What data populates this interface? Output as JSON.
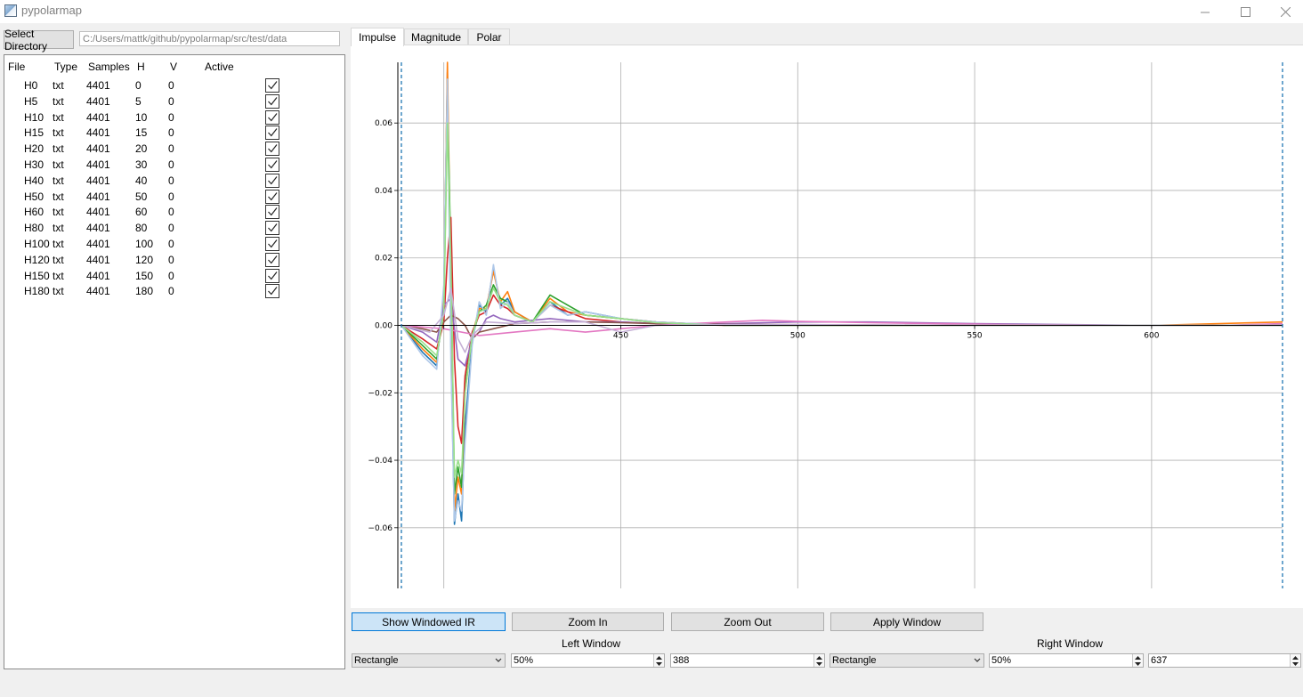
{
  "window": {
    "title": "pypolarmap"
  },
  "toolbar": {
    "select_directory_label": "Select Directory",
    "directory_path": "C:/Users/mattk/github/pypolarmap/src/test/data"
  },
  "table": {
    "columns": [
      "File",
      "Type",
      "Samples",
      "H",
      "V",
      "Active"
    ],
    "rows": [
      {
        "file": "H0",
        "type": "txt",
        "samples": "4401",
        "h": "0",
        "v": "0",
        "active": true
      },
      {
        "file": "H5",
        "type": "txt",
        "samples": "4401",
        "h": "5",
        "v": "0",
        "active": true
      },
      {
        "file": "H10",
        "type": "txt",
        "samples": "4401",
        "h": "10",
        "v": "0",
        "active": true
      },
      {
        "file": "H15",
        "type": "txt",
        "samples": "4401",
        "h": "15",
        "v": "0",
        "active": true
      },
      {
        "file": "H20",
        "type": "txt",
        "samples": "4401",
        "h": "20",
        "v": "0",
        "active": true
      },
      {
        "file": "H30",
        "type": "txt",
        "samples": "4401",
        "h": "30",
        "v": "0",
        "active": true
      },
      {
        "file": "H40",
        "type": "txt",
        "samples": "4401",
        "h": "40",
        "v": "0",
        "active": true
      },
      {
        "file": "H50",
        "type": "txt",
        "samples": "4401",
        "h": "50",
        "v": "0",
        "active": true
      },
      {
        "file": "H60",
        "type": "txt",
        "samples": "4401",
        "h": "60",
        "v": "0",
        "active": true
      },
      {
        "file": "H80",
        "type": "txt",
        "samples": "4401",
        "h": "80",
        "v": "0",
        "active": true
      },
      {
        "file": "H100",
        "type": "txt",
        "samples": "4401",
        "h": "100",
        "v": "0",
        "active": true
      },
      {
        "file": "H120",
        "type": "txt",
        "samples": "4401",
        "h": "120",
        "v": "0",
        "active": true
      },
      {
        "file": "H150",
        "type": "txt",
        "samples": "4401",
        "h": "150",
        "v": "0",
        "active": true
      },
      {
        "file": "H180",
        "type": "txt",
        "samples": "4401",
        "h": "180",
        "v": "0",
        "active": true
      }
    ]
  },
  "tabs": [
    {
      "label": "Impulse",
      "selected": true
    },
    {
      "label": "Magnitude",
      "selected": false
    },
    {
      "label": "Polar",
      "selected": false
    }
  ],
  "buttons": {
    "show_windowed_ir": "Show Windowed IR",
    "zoom_in": "Zoom In",
    "zoom_out": "Zoom Out",
    "apply_window": "Apply Window"
  },
  "left_window": {
    "label": "Left Window",
    "type": "Rectangle",
    "percent": "50%",
    "position": "388"
  },
  "right_window": {
    "label": "Right Window",
    "type": "Rectangle",
    "percent": "50%",
    "position": "637"
  },
  "colors": {
    "accent_active": "#cce4f7",
    "accent_border": "#0078d7",
    "window_marker": "#1f77b4"
  },
  "chart_data": {
    "type": "line",
    "xlim": [
      387,
      637
    ],
    "ylim": [
      -0.078,
      0.078
    ],
    "x_ticks": [
      400,
      450,
      500,
      550,
      600
    ],
    "x_tick_labels": [
      "",
      "450",
      "500",
      "550",
      "600"
    ],
    "y_ticks": [
      0.06,
      0.04,
      0.02,
      0.0,
      -0.02,
      -0.04,
      -0.06
    ],
    "y_tick_labels": [
      "0.06",
      "0.04",
      "0.02",
      "0.00",
      "−0.02",
      "−0.04",
      "−0.06"
    ],
    "grid": true,
    "window_markers": [
      388,
      637
    ],
    "series": [
      {
        "color": "#1f77b4",
        "x": [
          388,
          394,
          398,
          400,
          401,
          402,
          403,
          404,
          405,
          406,
          408,
          410,
          412,
          414,
          416,
          418,
          420,
          425,
          430,
          435,
          440,
          450,
          460,
          470,
          480,
          500,
          550,
          600,
          637
        ],
        "y": [
          0,
          -0.008,
          -0.012,
          0.01,
          0.075,
          -0.005,
          -0.059,
          -0.05,
          -0.058,
          -0.03,
          -0.005,
          0.006,
          0.004,
          0.017,
          0.006,
          0.008,
          0.004,
          0.001,
          0.007,
          0.003,
          0.004,
          0.002,
          0.001,
          0.0005,
          0,
          0,
          0,
          0,
          0
        ]
      },
      {
        "color": "#ff7f0e",
        "x": [
          388,
          394,
          398,
          400,
          401,
          402,
          403,
          404,
          405,
          406,
          408,
          410,
          412,
          414,
          416,
          418,
          420,
          425,
          430,
          435,
          440,
          450,
          460,
          470,
          480,
          500,
          550,
          600,
          637
        ],
        "y": [
          0,
          -0.007,
          -0.011,
          0.008,
          0.078,
          0.01,
          -0.055,
          -0.045,
          -0.05,
          -0.02,
          -0.003,
          0.005,
          0.005,
          0.016,
          0.007,
          0.01,
          0.004,
          0.001,
          0.008,
          0.004,
          0.003,
          0.002,
          0.001,
          0.0005,
          0,
          0,
          0,
          0,
          0.001
        ]
      },
      {
        "color": "#2ca02c",
        "x": [
          388,
          394,
          398,
          400,
          401,
          402,
          403,
          404,
          405,
          406,
          408,
          410,
          412,
          414,
          416,
          418,
          420,
          425,
          430,
          435,
          440,
          450,
          460,
          470,
          480,
          500,
          550,
          600,
          637
        ],
        "y": [
          0,
          -0.006,
          -0.01,
          0.005,
          0.067,
          0.02,
          -0.05,
          -0.042,
          -0.048,
          -0.018,
          -0.004,
          0.004,
          0.006,
          0.012,
          0.008,
          0.007,
          0.003,
          0.001,
          0.009,
          0.006,
          0.003,
          0.002,
          0.0008,
          0.0004,
          0,
          0,
          0,
          0,
          0
        ]
      },
      {
        "color": "#d62728",
        "x": [
          388,
          394,
          398,
          400,
          401,
          402,
          403,
          404,
          405,
          406,
          408,
          410,
          412,
          414,
          416,
          418,
          420,
          425,
          430,
          435,
          440,
          450,
          460,
          470,
          480,
          500,
          550,
          600,
          637
        ],
        "y": [
          0,
          -0.004,
          -0.007,
          0.001,
          0.02,
          0.032,
          -0.01,
          -0.03,
          -0.035,
          -0.015,
          -0.002,
          0.003,
          0.004,
          0.009,
          0.006,
          0.005,
          0.003,
          0.001,
          0.006,
          0.004,
          0.002,
          0.001,
          0.0005,
          0.0002,
          0,
          0,
          0,
          0,
          0
        ]
      },
      {
        "color": "#9467bd",
        "x": [
          388,
          394,
          398,
          400,
          402,
          404,
          406,
          408,
          410,
          412,
          414,
          416,
          420,
          430,
          440,
          450,
          460,
          480,
          500,
          520,
          550,
          600,
          637
        ],
        "y": [
          0,
          -0.002,
          -0.005,
          0.006,
          0.008,
          -0.01,
          -0.012,
          -0.004,
          -0.002,
          0.002,
          0.003,
          0.002,
          0.001,
          0.002,
          0.001,
          0.001,
          0.0005,
          0.0005,
          0.001,
          0.001,
          0.0005,
          0,
          0
        ]
      },
      {
        "color": "#8c564b",
        "x": [
          388,
          394,
          398,
          400,
          402,
          404,
          406,
          408,
          410,
          414,
          420,
          430,
          440,
          450,
          460,
          480,
          500,
          520,
          550,
          600,
          637
        ],
        "y": [
          0,
          -0.001,
          -0.002,
          0.001,
          0.003,
          0.002,
          0.0,
          -0.004,
          -0.002,
          -0.001,
          0.0005,
          0.001,
          0.001,
          0.0008,
          0.0005,
          0.0003,
          0.0002,
          0.0001,
          0,
          0,
          0
        ]
      },
      {
        "color": "#e377c2",
        "x": [
          388,
          400,
          410,
          420,
          430,
          440,
          450,
          460,
          470,
          480,
          490,
          500,
          510,
          520,
          540,
          560,
          600,
          620,
          637
        ],
        "y": [
          0,
          -0.001,
          -0.003,
          -0.002,
          -0.001,
          -0.002,
          -0.001,
          0.0,
          0.0005,
          0.001,
          0.0015,
          0.0012,
          0.001,
          0.0008,
          0.0005,
          0.0002,
          0,
          0,
          0.0005
        ]
      },
      {
        "color": "#aec7e8",
        "x": [
          388,
          394,
          398,
          400,
          401,
          402,
          403,
          404,
          405,
          406,
          408,
          410,
          412,
          414,
          416,
          418,
          420,
          425,
          430,
          435,
          440,
          450,
          460,
          470,
          480,
          500,
          550,
          600,
          637
        ],
        "y": [
          0,
          -0.009,
          -0.013,
          0.012,
          0.073,
          -0.01,
          -0.058,
          -0.052,
          -0.055,
          -0.035,
          -0.006,
          0.007,
          0.003,
          0.018,
          0.005,
          0.007,
          0.003,
          0.001,
          0.006,
          0.003,
          0.004,
          0.002,
          0.001,
          0.0005,
          0,
          0,
          0,
          0,
          0
        ]
      },
      {
        "color": "#98df8a",
        "x": [
          388,
          394,
          398,
          400,
          401,
          402,
          403,
          404,
          405,
          406,
          408,
          410,
          412,
          414,
          416,
          418,
          420,
          425,
          430,
          435,
          440,
          450,
          460,
          470,
          480,
          500,
          550,
          600,
          637
        ],
        "y": [
          0,
          -0.005,
          -0.009,
          0.004,
          0.06,
          0.018,
          -0.045,
          -0.04,
          -0.044,
          -0.02,
          -0.003,
          0.004,
          0.005,
          0.011,
          0.007,
          0.006,
          0.003,
          0.001,
          0.007,
          0.005,
          0.003,
          0.002,
          0.0008,
          0.0004,
          0,
          0,
          0,
          0,
          0
        ]
      },
      {
        "color": "#c5b0d5",
        "x": [
          388,
          396,
          400,
          402,
          404,
          406,
          408,
          412,
          420,
          430,
          440,
          450,
          460,
          480,
          500,
          550,
          600,
          637
        ],
        "y": [
          0,
          -0.002,
          0.003,
          0.011,
          -0.004,
          -0.008,
          -0.003,
          0.001,
          0.0005,
          0.001,
          0.001,
          -0.002,
          0.0,
          0.0002,
          0.0002,
          0,
          0,
          0
        ]
      }
    ]
  }
}
